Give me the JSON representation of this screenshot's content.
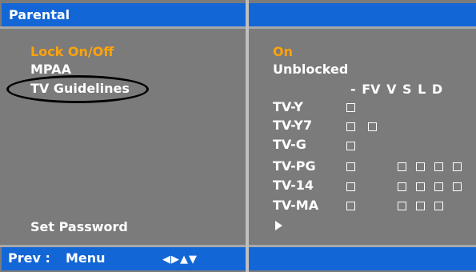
{
  "header": {
    "title": "Parental"
  },
  "left_menu": {
    "lock": "Lock On/Off",
    "mpaa": "MPAA",
    "tv_guidelines": "TV Guidelines",
    "set_password": "Set Password"
  },
  "right_panel": {
    "lock_value": "On",
    "mpaa_value": "Unblocked",
    "columns_header": "- FV V S L D",
    "ratings": [
      {
        "label": "TV-Y"
      },
      {
        "label": "TV-Y7"
      },
      {
        "label": "TV-G"
      },
      {
        "label": "TV-PG"
      },
      {
        "label": "TV-14"
      },
      {
        "label": "TV-MA"
      }
    ]
  },
  "footer": {
    "prev_label": "Prev :",
    "menu_label": "Menu",
    "nav_arrows": "◀▶▲▼"
  },
  "colors": {
    "panel_bg": "#7b7b7b",
    "bar_blue": "#1266d6",
    "highlight_orange": "#ffa30a"
  }
}
